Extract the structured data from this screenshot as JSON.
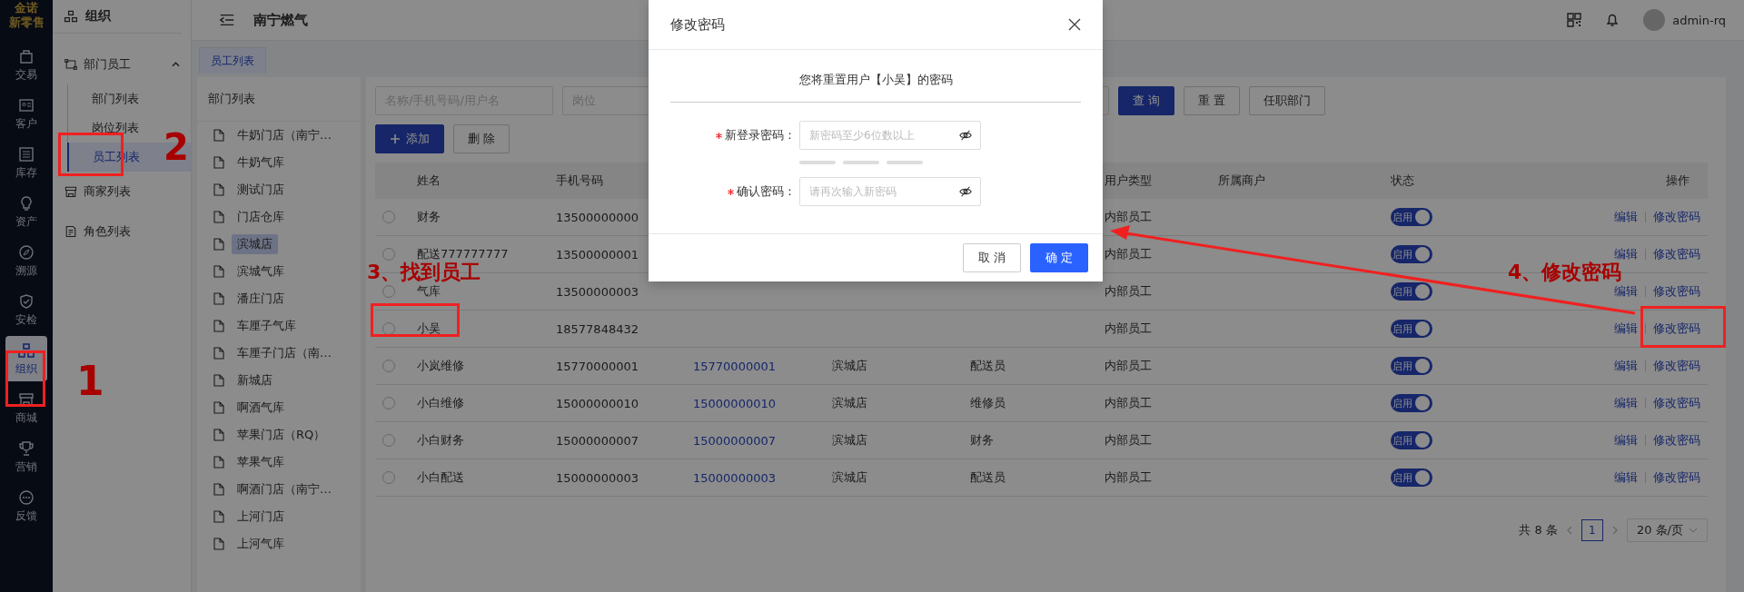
{
  "rail": {
    "logo": "金诺",
    "logo_subtitle": "新零售",
    "items": [
      {
        "label": "交易",
        "selected": false
      },
      {
        "label": "客户",
        "selected": false
      },
      {
        "label": "库存",
        "selected": false
      },
      {
        "label": "资产",
        "selected": false
      },
      {
        "label": "溯源",
        "selected": false
      },
      {
        "label": "安检",
        "selected": false
      },
      {
        "label": "组织",
        "selected": true
      },
      {
        "label": "商城",
        "selected": false
      },
      {
        "label": "营销",
        "selected": false
      },
      {
        "label": "反馈",
        "selected": false
      }
    ]
  },
  "sidebar": {
    "title": "组织",
    "items": [
      {
        "label": "部门员工",
        "expanded": true,
        "children": [
          {
            "label": "部门列表",
            "selected": false
          },
          {
            "label": "岗位列表",
            "selected": false
          },
          {
            "label": "员工列表",
            "selected": true
          }
        ]
      },
      {
        "label": "商家列表"
      },
      {
        "label": "角色列表"
      }
    ]
  },
  "header": {
    "title": "南宁燃气",
    "user": "admin-rq"
  },
  "tabs": [
    {
      "label": "员工列表",
      "selected": true
    }
  ],
  "department_list": {
    "title": "部门列表",
    "items": [
      {
        "label": "牛奶门店（南宁…",
        "selected": false
      },
      {
        "label": "牛奶气库",
        "selected": false
      },
      {
        "label": "测试门店",
        "selected": false
      },
      {
        "label": "门店仓库",
        "selected": false
      },
      {
        "label": "滨城店",
        "selected": true
      },
      {
        "label": "滨城气库",
        "selected": false
      },
      {
        "label": "潘庄门店",
        "selected": false
      },
      {
        "label": "车厘子气库",
        "selected": false
      },
      {
        "label": "车厘子门店（南…",
        "selected": false
      },
      {
        "label": "新城店",
        "selected": false
      },
      {
        "label": "啊酒气库",
        "selected": false
      },
      {
        "label": "苹果门店（RQ）",
        "selected": false
      },
      {
        "label": "苹果气库",
        "selected": false
      },
      {
        "label": "啊酒门店（南宁…",
        "selected": false
      },
      {
        "label": "上河门店",
        "selected": false
      },
      {
        "label": "上河气库",
        "selected": false
      }
    ]
  },
  "filters": {
    "search_placeholder": "名称/手机号码/用户名",
    "position_placeholder": "岗位",
    "buttons": [
      "查 询",
      "重 置",
      "任职部门"
    ]
  },
  "toolbar": {
    "add": "添加",
    "delete": "删 除"
  },
  "table": {
    "header": {
      "name": "姓名",
      "phone": "手机号码",
      "user_type": "用户类型",
      "merchant": "所属商户",
      "status": "状态",
      "actions": "操作"
    },
    "rows": [
      {
        "selected": false,
        "name": "财务",
        "phone": "13500000000",
        "user_type": "内部员工",
        "on": true,
        "status": "启用",
        "actions": [
          "编辑",
          "修改密码"
        ]
      },
      {
        "selected": false,
        "name": "配送777777777",
        "phone": "13500000001",
        "user_type": "内部员工",
        "on": true,
        "status": "启用",
        "actions": [
          "编辑",
          "修改密码"
        ]
      },
      {
        "selected": false,
        "name": "气库",
        "phone": "13500000003",
        "user_type": "内部员工",
        "on": true,
        "status": "启用",
        "actions": [
          "编辑",
          "修改密码"
        ]
      },
      {
        "selected": false,
        "name": "小吴",
        "phone": "18577848432",
        "user_type": "内部员工",
        "on": true,
        "status": "启用",
        "actions": [
          "编辑",
          "修改密码"
        ]
      },
      {
        "selected": false,
        "name": "小岚维修",
        "phone": "15770000001",
        "column_3": "15770000001",
        "column_4": "滨城店",
        "column_5": "配送员",
        "user_type": "内部员工",
        "on": true,
        "status": "启用",
        "actions": [
          "编辑",
          "修改密码"
        ]
      },
      {
        "selected": false,
        "name": "小白维修",
        "phone": "15000000010",
        "column_3": "15000000010",
        "column_4": "滨城店",
        "column_5": "维修员",
        "user_type": "内部员工",
        "on": true,
        "status": "启用",
        "actions": [
          "编辑",
          "修改密码"
        ]
      },
      {
        "selected": false,
        "name": "小白财务",
        "phone": "15000000007",
        "column_3": "15000000007",
        "column_4": "滨城店",
        "column_5": "财务",
        "user_type": "内部员工",
        "on": true,
        "status": "启用",
        "actions": [
          "编辑",
          "修改密码"
        ]
      },
      {
        "selected": false,
        "name": "小白配送",
        "phone": "15000000003",
        "column_3": "15000000003",
        "column_4": "滨城店",
        "column_5": "配送员",
        "user_type": "内部员工",
        "on": true,
        "status": "启用",
        "actions": [
          "编辑",
          "修改密码"
        ]
      }
    ]
  },
  "pagination": {
    "total": "共 8 条",
    "pages": [
      {
        "label": "1",
        "selected": true
      }
    ],
    "page_size": "20 条/页"
  },
  "dialog": {
    "title": "修改密码",
    "message": "您将重置用户【小吴】的密码",
    "fields": [
      {
        "kind": "new",
        "label": "新登录密码：",
        "required": true,
        "placeholder": "新密码至少6位数以上"
      },
      {
        "kind": "confirm",
        "label": "确认密码：",
        "required": true,
        "placeholder": "请再次输入新密码"
      }
    ],
    "buttons": [
      {
        "label": "取 消",
        "kind": "secondary"
      },
      {
        "label": "确 定",
        "kind": "primary"
      }
    ]
  },
  "annotations": [
    {
      "text": "1"
    },
    {
      "text": "2"
    },
    {
      "text": "3、找到员工"
    },
    {
      "text": "4、修改密码"
    }
  ]
}
